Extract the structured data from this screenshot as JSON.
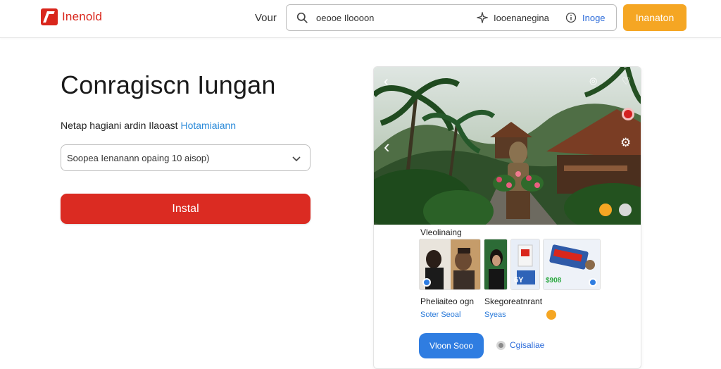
{
  "header": {
    "logo_text": "Inenold",
    "nav_link": "Vour",
    "search_query": "oeooe Iloooon",
    "lens_label": "Iooenanegina",
    "image_label": "Inoge",
    "cta_label": "Inanaton"
  },
  "main": {
    "title": "Conragiscn Iungan",
    "subtitle_text": "Netap hagiani ardin Ilaoast",
    "subtitle_link": "Hotamiaiann",
    "select_value": "Soopea Ienanann opaing 10 aisop)",
    "install_label": "Instal"
  },
  "panel": {
    "section_title": "Vleolinaing",
    "price_tag": "$908",
    "caption_1": "Pheliaiteo ogn",
    "caption_2": "Skegoreatnrant",
    "meta_1": "Soter Seoal",
    "meta_2": "Syeas",
    "primary_button": "Vloon Sooo",
    "secondary_link": "Cgisaliae",
    "thumb_2_label": "6Y"
  },
  "colors": {
    "brand_red": "#db2b22",
    "accent_orange": "#f5a623",
    "link_blue": "#2a7ad9",
    "button_blue": "#2f7de1"
  }
}
